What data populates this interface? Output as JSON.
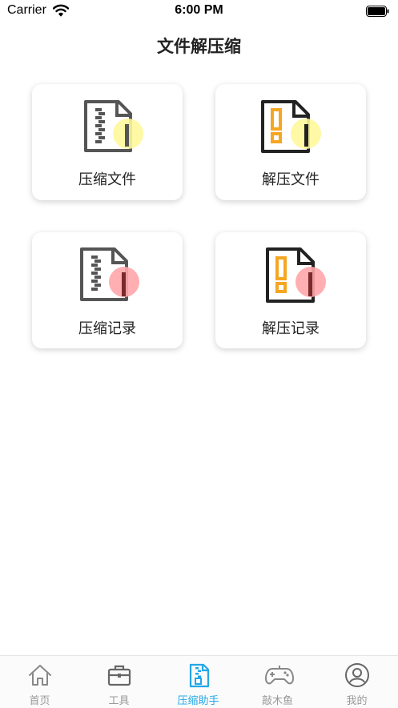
{
  "status_bar": {
    "carrier": "Carrier",
    "time": "6:00 PM"
  },
  "page": {
    "title": "文件解压缩"
  },
  "cards": [
    {
      "label": "压缩文件",
      "icon": "zip-file-icon",
      "badge_color": "#fff79a"
    },
    {
      "label": "解压文件",
      "icon": "unzip-file-icon",
      "badge_color": "#fff79a"
    },
    {
      "label": "压缩记录",
      "icon": "zip-history-icon",
      "badge_color": "#ffa6aa"
    },
    {
      "label": "解压记录",
      "icon": "unzip-history-icon",
      "badge_color": "#ffa6aa"
    }
  ],
  "tabs": [
    {
      "label": "首页",
      "icon": "home-icon",
      "active": false
    },
    {
      "label": "工具",
      "icon": "toolbox-icon",
      "active": false
    },
    {
      "label": "压缩助手",
      "icon": "zip-assistant-icon",
      "active": true
    },
    {
      "label": "敲木鱼",
      "icon": "gamepad-icon",
      "active": false
    },
    {
      "label": "我的",
      "icon": "profile-icon",
      "active": false
    }
  ],
  "colors": {
    "accent": "#23a7e6",
    "inactive": "#999999",
    "orange": "#f5a623"
  }
}
